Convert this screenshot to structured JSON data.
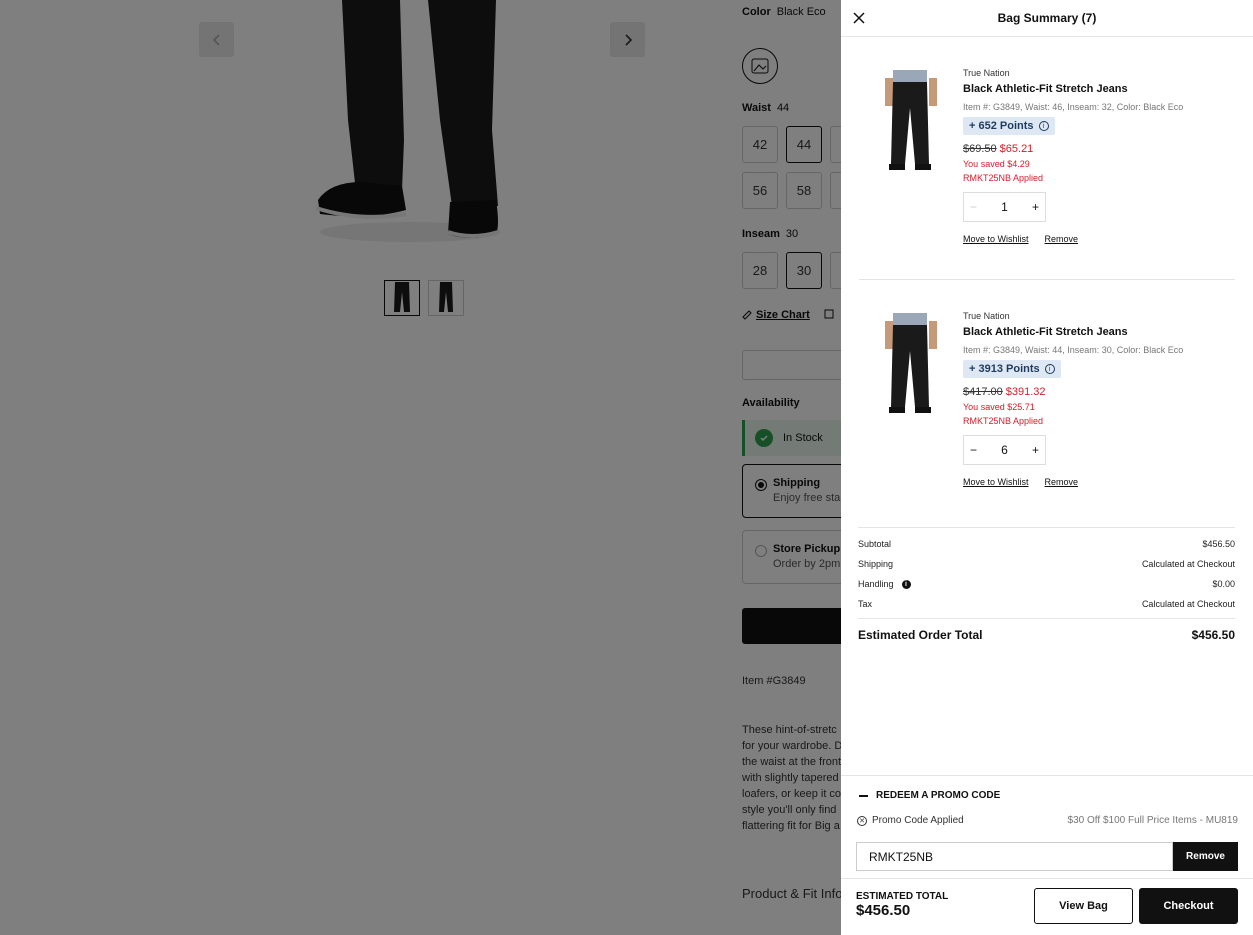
{
  "background": {
    "color": {
      "label": "Color",
      "value": "Black Eco"
    },
    "waist": {
      "label": "Waist",
      "value": "44",
      "options": [
        "42",
        "44",
        "56",
        "58"
      ]
    },
    "inseam": {
      "label": "Inseam",
      "value": "30",
      "options": [
        "28",
        "30"
      ]
    },
    "size_chart": "Size Chart",
    "availability": "Availability",
    "in_stock": "In Stock",
    "shipping": {
      "title": "Shipping",
      "sub": "Enjoy free sta"
    },
    "pickup": {
      "title": "Store Pickup",
      "sub": "Order by 2pm"
    },
    "item_number": "Item #G3849",
    "description": [
      "These hint-of-stretc",
      "for your wardrobe. D",
      "the waist at the front",
      "with slightly tapered",
      "loafers, or keep it co",
      "style you'll only find",
      "flattering fit for Big a"
    ],
    "product_fit": "Product & Fit Info"
  },
  "drawer": {
    "title": "Bag Summary (7)",
    "items": [
      {
        "brand": "True Nation",
        "name": "Black Athletic-Fit Stretch Jeans",
        "meta": "Item #: G3849, Waist: 46, Inseam: 32, Color: Black Eco",
        "points": "+ 652 Points",
        "old_price": "$69.50",
        "new_price": "$65.21",
        "saved": "You saved $4.29",
        "promo": "RMKT25NB Applied",
        "qty": "1",
        "wishlist": "Move to Wishlist",
        "remove": "Remove"
      },
      {
        "brand": "True Nation",
        "name": "Black Athletic-Fit Stretch Jeans",
        "meta": "Item #: G3849, Waist: 44, Inseam: 30, Color: Black Eco",
        "points": "+ 3913 Points",
        "old_price": "$417.00",
        "new_price": "$391.32",
        "saved": "You saved $25.71",
        "promo": "RMKT25NB Applied",
        "qty": "6",
        "wishlist": "Move to Wishlist",
        "remove": "Remove"
      }
    ],
    "summary": {
      "subtotal": {
        "label": "Subtotal",
        "value": "$456.50"
      },
      "shipping": {
        "label": "Shipping",
        "value": "Calculated at Checkout"
      },
      "handling": {
        "label": "Handling",
        "value": "$0.00"
      },
      "tax": {
        "label": "Tax",
        "value": "Calculated at Checkout"
      },
      "total": {
        "label": "Estimated Order Total",
        "value": "$456.50"
      }
    },
    "promo": {
      "heading": "REDEEM A PROMO CODE",
      "applied_label": "Promo Code Applied",
      "applied_detail": "$30 Off $100 Full Price Items - MU819",
      "code": "RMKT25NB",
      "remove": "Remove"
    },
    "footer": {
      "est_label": "ESTIMATED TOTAL",
      "est_value": "$456.50",
      "view_bag": "View Bag",
      "checkout": "Checkout"
    }
  },
  "colors": {
    "accent": "#111111",
    "sale": "#d0202e",
    "points_bg": "#dde8f4",
    "stock": "#2e9e4f"
  }
}
